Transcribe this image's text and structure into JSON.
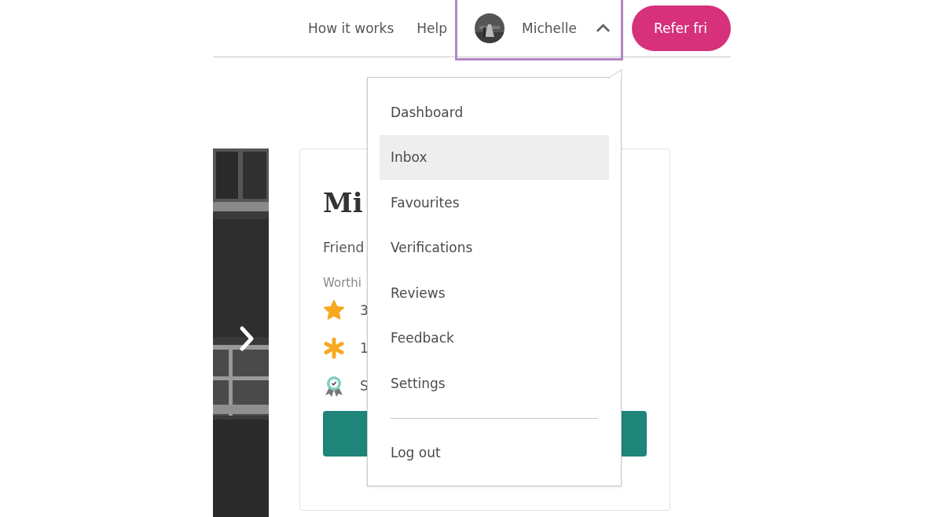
{
  "nav": {
    "links": [
      "How it works",
      "Help"
    ],
    "user": {
      "name": "Michelle",
      "expanded": true
    },
    "cta": "Refer fri"
  },
  "profile": {
    "title": "Mi",
    "subtitle": "Friend",
    "location": "Worthi",
    "stats": [
      {
        "kind": "rating",
        "text": "3"
      },
      {
        "kind": "reviews",
        "text": "1"
      },
      {
        "kind": "badge",
        "text": "S"
      }
    ]
  },
  "menu": {
    "items": [
      {
        "label": "Dashboard",
        "selected": false
      },
      {
        "label": "Inbox",
        "selected": true
      },
      {
        "label": "Favourites",
        "selected": false
      },
      {
        "label": "Verifications",
        "selected": false
      },
      {
        "label": "Reviews",
        "selected": false
      },
      {
        "label": "Feedback",
        "selected": false
      },
      {
        "label": "Settings",
        "selected": false
      }
    ],
    "logout": "Log out"
  }
}
